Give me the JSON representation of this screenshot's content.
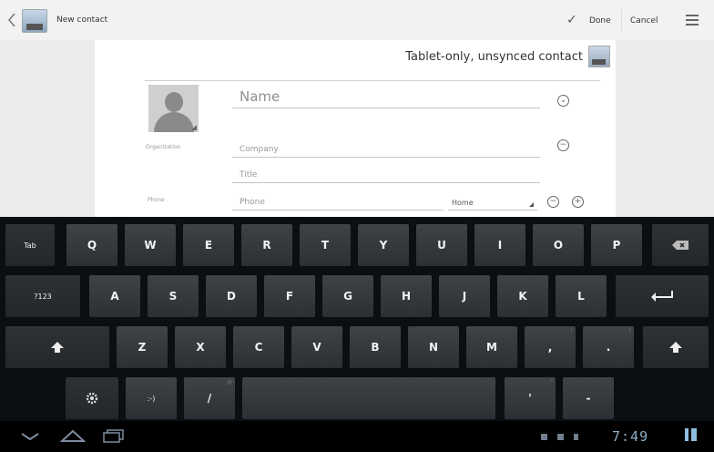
{
  "app_bar": {
    "title": "New contact",
    "done_label": "Done",
    "cancel_label": "Cancel"
  },
  "form": {
    "account_label": "Tablet-only, unsynced contact",
    "name_placeholder": "Name",
    "organization_label": "Organization",
    "company_placeholder": "Company",
    "title_placeholder": "Title",
    "phone_label": "Phone",
    "phone_placeholder": "Phone",
    "phone_type": "Home"
  },
  "keyboard": {
    "row1": [
      "Tab",
      "Q",
      "W",
      "E",
      "R",
      "T",
      "Y",
      "U",
      "I",
      "O",
      "P"
    ],
    "row2": [
      "?123",
      "A",
      "S",
      "D",
      "F",
      "G",
      "H",
      "J",
      "K",
      "L"
    ],
    "row3": [
      "Z",
      "X",
      "C",
      "V",
      "B",
      "N",
      "M",
      ",",
      "."
    ],
    "row4": [
      ":-)",
      "/",
      "'",
      "-"
    ],
    "row3_hints": [
      "!",
      "?"
    ],
    "row4_hints": [
      "@",
      "\""
    ]
  },
  "status_bar": {
    "time": "7:49"
  },
  "colors": {
    "keyboard_bg": "#0c0f12",
    "key_bg": "#3a3f43",
    "form_bg": "#ffffff",
    "status_accent": "#8eb0c8"
  }
}
